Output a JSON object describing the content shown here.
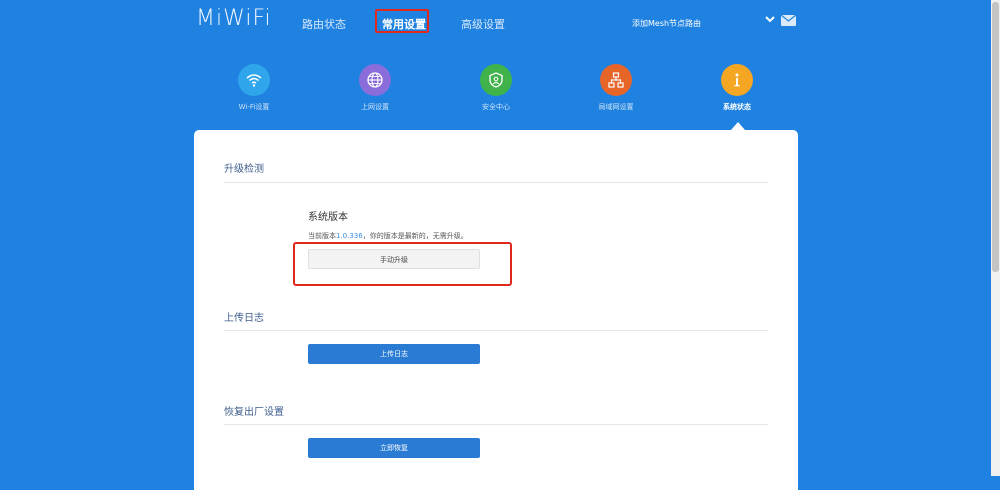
{
  "header": {
    "logo": "MiWiFi",
    "tabs": [
      {
        "label": "路由状态"
      },
      {
        "label": "常用设置"
      },
      {
        "label": "高级设置"
      }
    ],
    "mesh_link": "添加Mesh节点路由"
  },
  "icons": [
    {
      "label": "Wi-Fi设置",
      "icon": "wifi-icon",
      "color": "#2fa6ec"
    },
    {
      "label": "上网设置",
      "icon": "globe-icon",
      "color": "#8a6cdb"
    },
    {
      "label": "安全中心",
      "icon": "shield-icon",
      "color": "#3fb24a"
    },
    {
      "label": "局域网设置",
      "icon": "network-icon",
      "color": "#e8652a"
    },
    {
      "label": "系统状态",
      "icon": "info-icon",
      "color": "#f5a623"
    }
  ],
  "upgrade": {
    "title": "升级检测",
    "subtitle": "系统版本",
    "version_prefix": "当前版本",
    "version": "1.0.336",
    "version_suffix": "，你的版本是最新的，无需升级。",
    "button": "手动升级"
  },
  "log": {
    "title": "上传日志",
    "button": "上传日志"
  },
  "reset": {
    "title": "恢复出厂设置",
    "button": "立即恢复"
  }
}
